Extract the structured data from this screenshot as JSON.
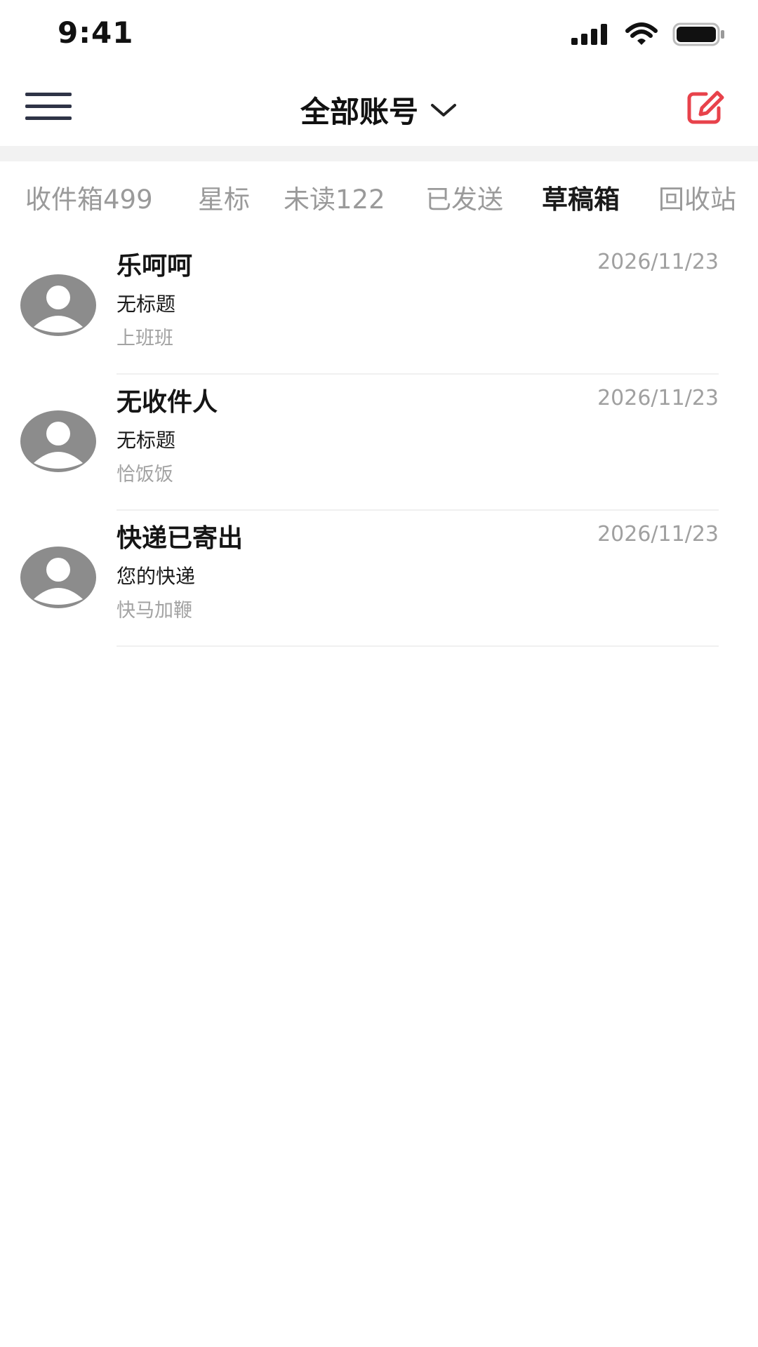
{
  "status_bar": {
    "time": "9:41"
  },
  "header": {
    "account_title": "全部账号",
    "accent_color": "#e8424b"
  },
  "tabs": [
    {
      "label": "收件箱499",
      "active": false
    },
    {
      "label": "星标",
      "active": false
    },
    {
      "label": "未读122",
      "active": false
    },
    {
      "label": "已发送",
      "active": false
    },
    {
      "label": "草稿箱",
      "active": true
    },
    {
      "label": "回收站",
      "active": false
    }
  ],
  "mails": [
    {
      "sender": "乐呵呵",
      "date": "2026/11/23",
      "subject": "无标题",
      "preview": "上班班"
    },
    {
      "sender": "无收件人",
      "date": "2026/11/23",
      "subject": "无标题",
      "preview": "恰饭饭"
    },
    {
      "sender": "快递已寄出",
      "date": "2026/11/23",
      "subject": "您的快递",
      "preview": "快马加鞭"
    }
  ]
}
